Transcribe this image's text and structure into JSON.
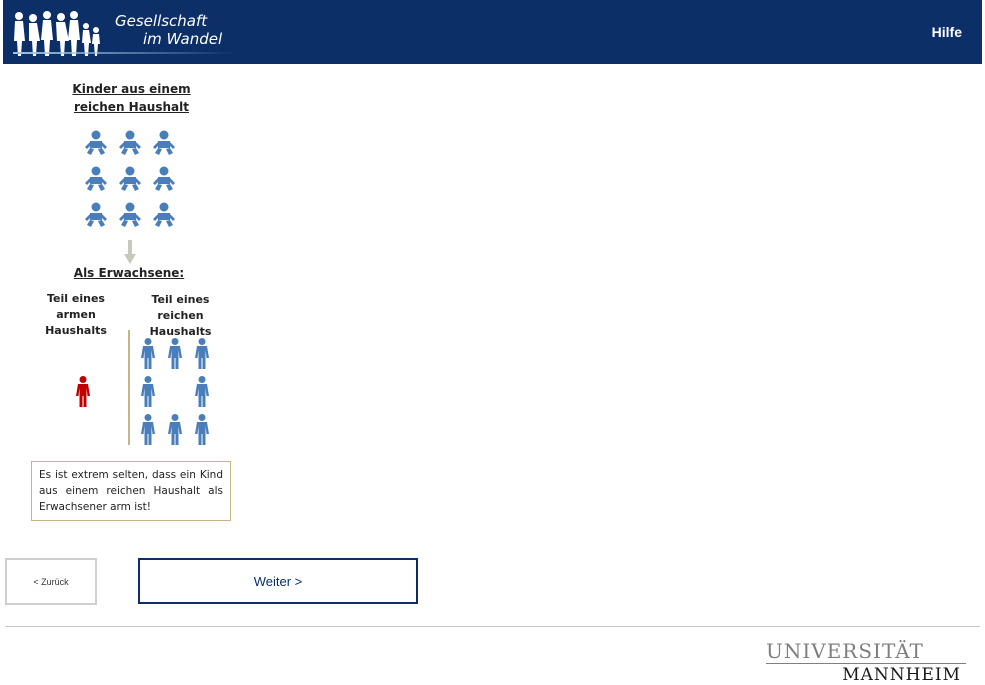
{
  "header": {
    "logo_line1": "Gesellschaft",
    "logo_line2": "im Wandel",
    "help_label": "Hilfe",
    "color": "#0b2f66"
  },
  "infographic": {
    "title_children": "Kinder aus einem reichen Haushalt",
    "title_adults": "Als Erwachsene:",
    "label_poor": "Teil eines armen Haushalts",
    "label_rich": "Teil eines reichen Haushalts",
    "children_count": 9,
    "poor_adults_count": 1,
    "rich_adults_count": 8,
    "baby_icon": "baby-icon",
    "person_icon": "person-icon",
    "person_poor_color": "#c00000",
    "person_rich_color": "#4a7ebb",
    "note": "Es ist extrem selten, dass ein Kind aus einem reichen Haushalt als Erwachsener arm ist!"
  },
  "nav": {
    "back_label": "< Zurück",
    "next_label": "Weiter >"
  },
  "footer": {
    "university_line1": "UNIVERSITÄT",
    "university_line2": "MANNHEIM"
  }
}
